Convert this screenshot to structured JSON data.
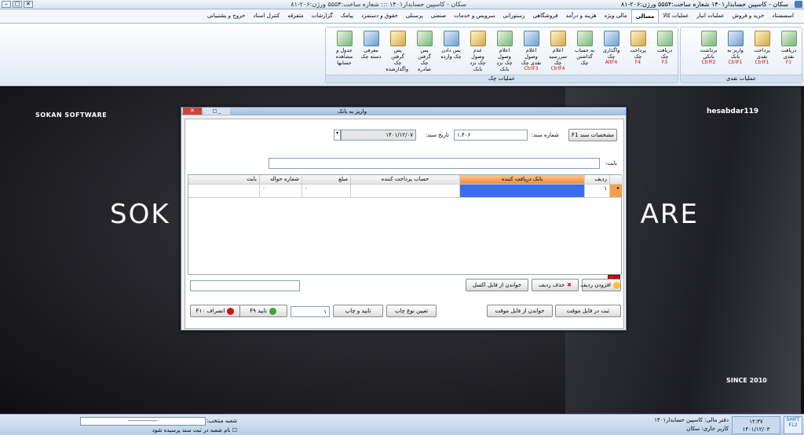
{
  "titlebar": {
    "app": "سکان - کاسپین حسابدار۱۴۰۱ شعاره ساخت:۵۵۵۴ ورژن:۲۰۶-۸۱",
    "center": "سکان - کاسپین حسابدار۱۴۰۱ ::: شعاره ساخت:۵۵۵۴ ورژن:۲۰۶-۸۱"
  },
  "tabs": [
    "اسسستاد",
    "خرید و فروش",
    "عملیات انبار",
    "عملیات کالا",
    "مسالی",
    "مالی ویژه",
    "هزینه و درآمد",
    "فروشگاهی",
    "رستورانی",
    "سرویس و خدمات",
    "صنعتی",
    "پرسنلی",
    "حقوق و دستمزد",
    "پیامک",
    "گزارشات",
    "متفرقه",
    "کنترل اسناد",
    "خروج و پشتیبانی"
  ],
  "active_tab": "مسالی",
  "ribbon": {
    "group_cash": "عملیات نقدی",
    "group_cheque": "عملیات چک",
    "cash": [
      {
        "l": "دریافت نقدی",
        "s": "F1"
      },
      {
        "l": "پرداخت نقدی",
        "s": "CtrlF1"
      },
      {
        "l": "واریز به بانک",
        "s": "CtrlF1"
      },
      {
        "l": "برداشت بانکی",
        "s": "CtrlF2"
      }
    ],
    "cheque": [
      {
        "l": "دریافت چک",
        "s": "F3"
      },
      {
        "l": "پرداخت چک",
        "s": "F4"
      },
      {
        "l": "واگذاری چک",
        "s": "AltF4"
      },
      {
        "l": "به حساب گذاشتن چک",
        "s": ""
      },
      {
        "l": "اعلام سررسید چک",
        "s": "CtrlF4"
      },
      {
        "l": "اعلام وصول نقدی چک",
        "s": "CtrlF3"
      },
      {
        "l": "اعلام وصول چک نزد بانک",
        "s": ""
      },
      {
        "l": "عدم وصول چک نزد بانک",
        "s": ""
      },
      {
        "l": "پس دادن چک وارده",
        "s": ""
      },
      {
        "l": "پس گرفتن چک صادره",
        "s": ""
      },
      {
        "l": "پس گرفتن چک واگذارشده",
        "s": ""
      },
      {
        "l": "معرفی دسته چک",
        "s": ""
      },
      {
        "l": "جدول و مشاهده حسابها",
        "s": ""
      }
    ]
  },
  "desktop": {
    "brand_left": "SOKAN SOFTWARE",
    "brand_right": "hesabdar119",
    "big_left": "SOK",
    "big_right": "ARE",
    "since": "SINCE 2010"
  },
  "dialog": {
    "title": "واریز به بانک",
    "header_button": "مشخصات سند F1",
    "doc_no_label": "شماره سند:",
    "doc_no": "۱،۴۰۶",
    "date_label": "تاریخ سند:",
    "date": "۱۴۰۱/۱۲/۰۷",
    "babat_label": "بابت:",
    "columns": [
      "ردیف",
      "بانک دریافت کننده",
      "حساب پرداخت کننده",
      "مبلغ",
      "شماره حواله",
      "بابت"
    ],
    "row": {
      "radif": "۱",
      "bank": "",
      "account": "",
      "amount": "۰",
      "havale": "۰",
      "babat": ""
    },
    "print_tag": "چاپ",
    "add_row": "افزودن ردیف",
    "delete_row": "حذف ردیف",
    "read_excel": "خواندن از فایل اکسل",
    "save_temp": "ثبت در فایل موقت",
    "read_temp": "خواندن از فایل موقت",
    "print_type": "تعیین نوع چاپ",
    "confirm_print": "تایید و چاپ",
    "copies": "۱",
    "confirm": "تایید F۹",
    "cancel": "انصراف F۱۰"
  },
  "status": {
    "office": "دفتر مالی: کاسپین حسابدار۱۴۰۱",
    "user": "کاربر جاری: سکان",
    "time": "۱۲:۳۷",
    "date": "۱۴۰۱/۱۲/۰۳",
    "shift": "SHIFT F12",
    "branch_label": "شعبه منتخب:",
    "branch_value": "---------------",
    "branch_check": "نام شعبه در ثبت سند پرسیده شود"
  },
  "colors": {
    "accent": "#f08a3a",
    "selection": "#3a6ee8",
    "danger": "#d01010"
  }
}
